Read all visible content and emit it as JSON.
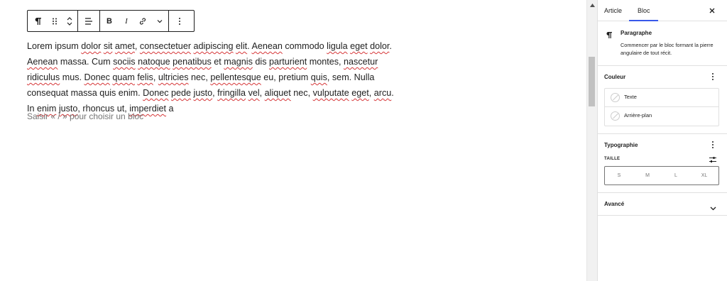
{
  "editor": {
    "toolbar": {
      "icons": [
        "paragraph-icon",
        "drag-handle-icon",
        "move-updown-icon",
        "align-icon",
        "bold-icon",
        "italic-icon",
        "link-icon",
        "more-formatting-icon",
        "options-icon"
      ],
      "bold_label": "B",
      "italic_label": "I"
    },
    "paragraph": {
      "segments": [
        {
          "t": "Lorem ipsum ",
          "s": false
        },
        {
          "t": "dolor",
          "s": true
        },
        {
          "t": " ",
          "s": false
        },
        {
          "t": "sit",
          "s": true
        },
        {
          "t": " ",
          "s": false
        },
        {
          "t": "amet",
          "s": true
        },
        {
          "t": ", ",
          "s": false
        },
        {
          "t": "consectetuer",
          "s": true
        },
        {
          "t": " ",
          "s": false
        },
        {
          "t": "adipiscing",
          "s": true
        },
        {
          "t": " ",
          "s": false
        },
        {
          "t": "elit",
          "s": true
        },
        {
          "t": ". ",
          "s": false
        },
        {
          "t": "Aenean",
          "s": true
        },
        {
          "t": " commodo ",
          "s": false
        },
        {
          "t": "ligula",
          "s": true
        },
        {
          "t": " ",
          "s": false
        },
        {
          "t": "eget",
          "s": true
        },
        {
          "t": " ",
          "s": false
        },
        {
          "t": "dolor",
          "s": true
        },
        {
          "t": ". ",
          "s": false
        },
        {
          "t": "Aenean",
          "s": true
        },
        {
          "t": " massa. Cum ",
          "s": false
        },
        {
          "t": "sociis",
          "s": true
        },
        {
          "t": " ",
          "s": false
        },
        {
          "t": "natoque",
          "s": true
        },
        {
          "t": " ",
          "s": false
        },
        {
          "t": "penatibus",
          "s": true
        },
        {
          "t": " et ",
          "s": false
        },
        {
          "t": "magnis",
          "s": true
        },
        {
          "t": " dis ",
          "s": false
        },
        {
          "t": "parturient",
          "s": true
        },
        {
          "t": " montes, ",
          "s": false
        },
        {
          "t": "nascetur",
          "s": true
        },
        {
          "t": " ",
          "s": false
        },
        {
          "t": "ridiculus",
          "s": true
        },
        {
          "t": " mus. ",
          "s": false
        },
        {
          "t": "Donec",
          "s": true
        },
        {
          "t": " ",
          "s": false
        },
        {
          "t": "quam",
          "s": true
        },
        {
          "t": " ",
          "s": false
        },
        {
          "t": "felis",
          "s": true
        },
        {
          "t": ", ",
          "s": false
        },
        {
          "t": "ultricies",
          "s": true
        },
        {
          "t": " nec, ",
          "s": false
        },
        {
          "t": "pellentesque",
          "s": true
        },
        {
          "t": " eu, pretium ",
          "s": false
        },
        {
          "t": "quis",
          "s": true
        },
        {
          "t": ", sem. Nulla consequat massa quis enim. ",
          "s": false
        },
        {
          "t": "Donec",
          "s": true
        },
        {
          "t": " ",
          "s": false
        },
        {
          "t": "pede",
          "s": true
        },
        {
          "t": " ",
          "s": false
        },
        {
          "t": "justo",
          "s": true
        },
        {
          "t": ", ",
          "s": false
        },
        {
          "t": "fringilla",
          "s": true
        },
        {
          "t": " ",
          "s": false
        },
        {
          "t": "vel",
          "s": true
        },
        {
          "t": ", ",
          "s": false
        },
        {
          "t": "aliquet",
          "s": true
        },
        {
          "t": " nec, ",
          "s": false
        },
        {
          "t": "vulputate",
          "s": true
        },
        {
          "t": " ",
          "s": false
        },
        {
          "t": "eget",
          "s": true
        },
        {
          "t": ", ",
          "s": false
        },
        {
          "t": "arcu",
          "s": true
        },
        {
          "t": ". In ",
          "s": false
        },
        {
          "t": "enim",
          "s": true
        },
        {
          "t": " ",
          "s": false
        },
        {
          "t": "justo",
          "s": true
        },
        {
          "t": ", rhoncus ut, ",
          "s": false
        },
        {
          "t": "imperdiet",
          "s": true
        },
        {
          "t": " a",
          "s": false
        }
      ]
    },
    "appender_placeholder": "Saisir « / » pour choisir un bloc"
  },
  "sidebar": {
    "tabs": [
      {
        "label": "Article",
        "active": false
      },
      {
        "label": "Bloc",
        "active": true
      }
    ],
    "close_icon": "close-icon",
    "block": {
      "icon": "paragraph-icon",
      "name": "Paragraphe",
      "description": "Commencer par le bloc formant la pierre angulaire de tout récit."
    },
    "color_panel": {
      "title": "Couleur",
      "items": [
        {
          "label": "Texte"
        },
        {
          "label": "Arrière-plan"
        }
      ]
    },
    "typography_panel": {
      "title": "Typographie",
      "size_label": "TAILLE",
      "sizes": [
        "S",
        "M",
        "L",
        "XL"
      ]
    },
    "advanced_panel": {
      "title": "Avancé"
    }
  },
  "colors": {
    "accent": "#3858e9",
    "spellcheck": "#d63638",
    "border": "#1e1e1e",
    "muted": "#757575"
  }
}
